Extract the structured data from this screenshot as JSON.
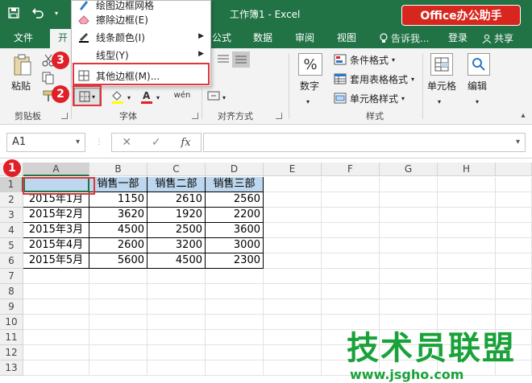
{
  "titlebar": {
    "doc_title": "工作簿1 - Excel",
    "brand": "Office办公助手"
  },
  "tabs": [
    {
      "label": "文件"
    },
    {
      "label": "开"
    },
    {
      "label": "公式"
    },
    {
      "label": "数据"
    },
    {
      "label": "审阅"
    },
    {
      "label": "视图"
    }
  ],
  "tell_me": "告诉我...",
  "login": "登录",
  "share": "共享",
  "colors": {
    "excel_green": "#217346",
    "marker_red": "#e01f26",
    "header_fill": "#bdd7ee",
    "watermark_green": "#1aa23a"
  },
  "ribbon": {
    "paste": "粘贴",
    "clipboard_group": "剪贴板",
    "font_group": "字体",
    "align_group": "对齐方式",
    "styles_group": "样式",
    "number_btn": "数字",
    "conditional_fmt": "条件格式",
    "table_fmt": "套用表格格式",
    "cell_style": "单元格样式",
    "cells_btn": "单元格",
    "edit_btn": "编辑",
    "pinyin": "wén"
  },
  "menu": {
    "items": [
      {
        "label": "绘图边框网格",
        "icon": "pen-grid-icon"
      },
      {
        "label": "擦除边框(E)",
        "icon": "eraser-icon"
      },
      {
        "label": "线条颜色(I)",
        "icon": "line-color-icon"
      },
      {
        "label": "线型(Y)",
        "icon": "line-style-icon"
      },
      {
        "label": "其他边框(M)...",
        "icon": "border-grid-icon"
      }
    ]
  },
  "markers": {
    "m1": "1",
    "m2": "2",
    "m3": "3"
  },
  "formula_bar": {
    "name_box": "A1",
    "fx": "fx"
  },
  "sheet": {
    "columns": [
      "A",
      "B",
      "C",
      "D",
      "E",
      "F",
      "G",
      "H"
    ],
    "rows": [
      "1",
      "2",
      "3",
      "4",
      "5",
      "6",
      "7",
      "8",
      "9",
      "10",
      "11",
      "12",
      "13"
    ],
    "headers": [
      "",
      "销售一部",
      "销售二部",
      "销售三部"
    ],
    "data": [
      [
        "2015年1月",
        "1150",
        "2610",
        "2560"
      ],
      [
        "2015年2月",
        "3620",
        "1920",
        "2200"
      ],
      [
        "2015年3月",
        "4500",
        "2500",
        "3600"
      ],
      [
        "2015年4月",
        "2600",
        "3200",
        "3000"
      ],
      [
        "2015年5月",
        "5600",
        "4500",
        "2300"
      ]
    ]
  },
  "watermark": {
    "big": "技术员联盟",
    "small": "www.jsgho.com"
  }
}
